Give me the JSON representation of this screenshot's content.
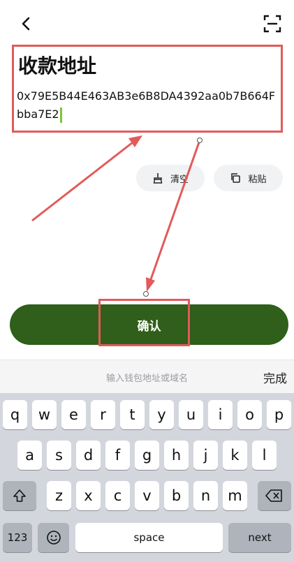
{
  "header": {
    "back_icon": "chevron-left-icon",
    "scan_icon": "scan-frame-icon"
  },
  "address": {
    "title": "收款地址",
    "value": "0x79E5B44E463AB3e6B8DA4392aa0b7B664Fbba7E2"
  },
  "actions": {
    "clear_label": "清空",
    "paste_label": "粘贴"
  },
  "confirm": {
    "label": "确认"
  },
  "keyboard_bar": {
    "placeholder": "输入钱包地址或域名",
    "done_label": "完成"
  },
  "keyboard": {
    "row1": [
      "q",
      "w",
      "e",
      "r",
      "t",
      "y",
      "u",
      "i",
      "o",
      "p"
    ],
    "row2": [
      "a",
      "s",
      "d",
      "f",
      "g",
      "h",
      "j",
      "k",
      "l"
    ],
    "row3": [
      "z",
      "x",
      "c",
      "v",
      "b",
      "n",
      "m"
    ],
    "numbers_label": "123",
    "space_label": "space",
    "next_label": "next"
  },
  "colors": {
    "accent": "#2f5f1a",
    "annotation": "#e25a5a",
    "caret": "#7dc63a"
  }
}
